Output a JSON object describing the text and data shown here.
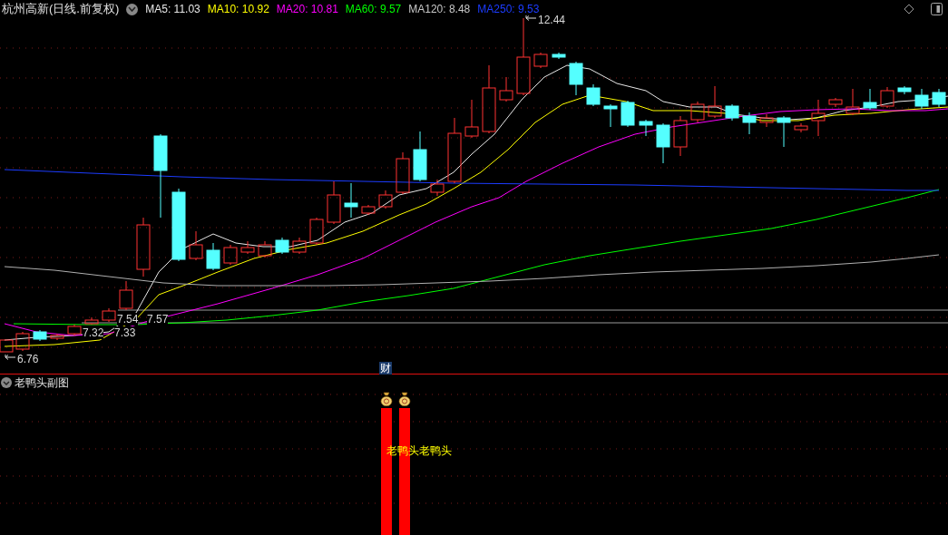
{
  "stock_title": "杭州高新(日线.前复权)",
  "indicators": [
    {
      "text": "MA5: 11.03",
      "color": "#e8e8e8"
    },
    {
      "text": "MA10: 10.92",
      "color": "#ffff00"
    },
    {
      "text": "MA20: 10.81",
      "color": "#ff00ff"
    },
    {
      "text": "MA60: 9.57",
      "color": "#00ff00"
    },
    {
      "text": "MA120: 8.48",
      "color": "#c8c8c8"
    },
    {
      "text": "MA250: 9.53",
      "color": "#1c3cff"
    }
  ],
  "price_labels": [
    {
      "text": "12.44",
      "kind": "arrow"
    },
    {
      "text": "7.54",
      "kind": "plain"
    },
    {
      "text": "7.57",
      "kind": "plain"
    },
    {
      "text": "7.32",
      "kind": "plain"
    },
    {
      "text": "7.33",
      "kind": "plain"
    },
    {
      "text": "6.76",
      "kind": "arrow"
    }
  ],
  "finance_marker": "财",
  "subchart": {
    "title": "老鸭头副图",
    "signal_labels": [
      "老鸭头",
      "老鸭头"
    ]
  }
}
